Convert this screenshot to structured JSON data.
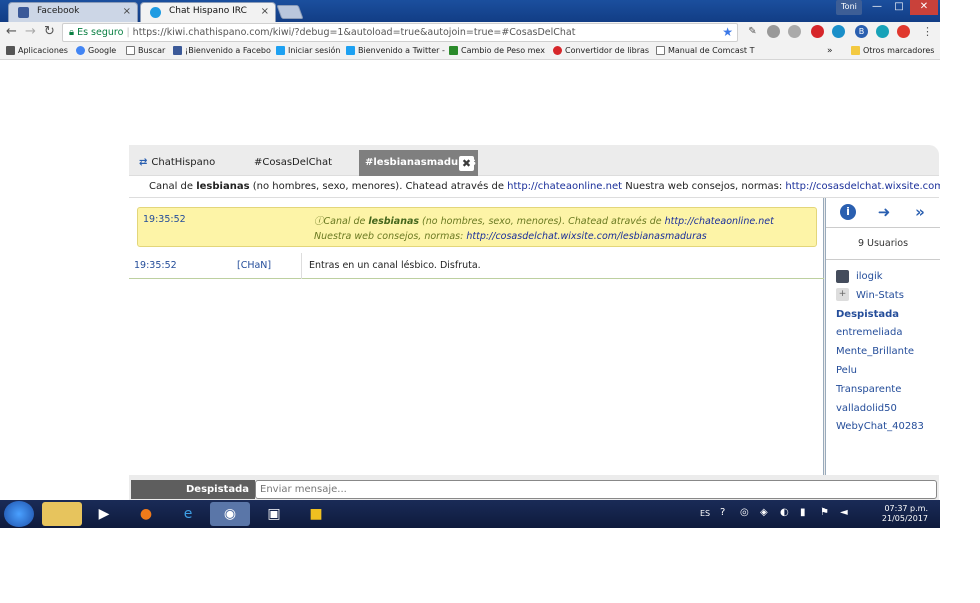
{
  "browser": {
    "tabs": [
      {
        "label": "Facebook",
        "close": "×"
      },
      {
        "label": "Chat Hispano IRC",
        "close": "×"
      }
    ],
    "user_badge": "Toni",
    "url_secure_label": "Es seguro",
    "url": "https://kiwi.chathispano.com/kiwi/?debug=1&autoload=true&autojoin=true=#CosasDelChat",
    "bookmarks": [
      "Aplicaciones",
      "Google",
      "Buscar",
      "¡Bienvenido a Facebo",
      "Iniciar sesión",
      "Bienvenido a Twitter -",
      "Cambio de Peso mex",
      "Convertidor de libras",
      "Manual de Comcast T",
      "Otros marcadores"
    ],
    "bookmarks_more": "»"
  },
  "chat": {
    "tabs": [
      "ChatHispano",
      "#CosasDelChat",
      "#lesbianasmaduras"
    ],
    "topic": {
      "pre": "Canal de ",
      "bold": "lesbianas",
      "mid": " (no hombres, sexo, menores). Chatead através de ",
      "link1": "http://chateaonline.net",
      "mid2": " Nuestra web consejos, normas: ",
      "link2": "http://cosasdelchat.wixsite.com/lesbianasmaduras"
    },
    "notice": {
      "time": "19:35:52",
      "pre": "Canal de ",
      "bold": "lesbianas",
      "mid": " (no hombres, sexo, menores). Chatead através de ",
      "link1": "http://chateaonline.net",
      "mid2": " Nuestra web consejos, normas: ",
      "link2": "http://cosasdelchat.wixsite.com/lesbianasmaduras"
    },
    "messages": [
      {
        "time": "19:35:52",
        "nick": "[CHaN]",
        "text": "Entras en un canal lésbico. Disfruta."
      }
    ],
    "user_count": "9 Usuarios",
    "users": [
      {
        "name": "ilogik",
        "style": "op"
      },
      {
        "name": "Win-Stats",
        "style": "bot"
      },
      {
        "name": "Despistada",
        "style": "self"
      },
      {
        "name": "entremeliada",
        "style": "normal"
      },
      {
        "name": "Mente_Brillante",
        "style": "normal"
      },
      {
        "name": "Pelu",
        "style": "normal"
      },
      {
        "name": "Transparente",
        "style": "normal"
      },
      {
        "name": "valladolid50",
        "style": "normal"
      },
      {
        "name": "WebyChat_40283",
        "style": "normal"
      }
    ],
    "nick": "Despistada",
    "input_placeholder": "Enviar mensaje..."
  },
  "taskbar": {
    "lang": "ES",
    "time": "07:37 p.m.",
    "date": "21/05/2017"
  }
}
